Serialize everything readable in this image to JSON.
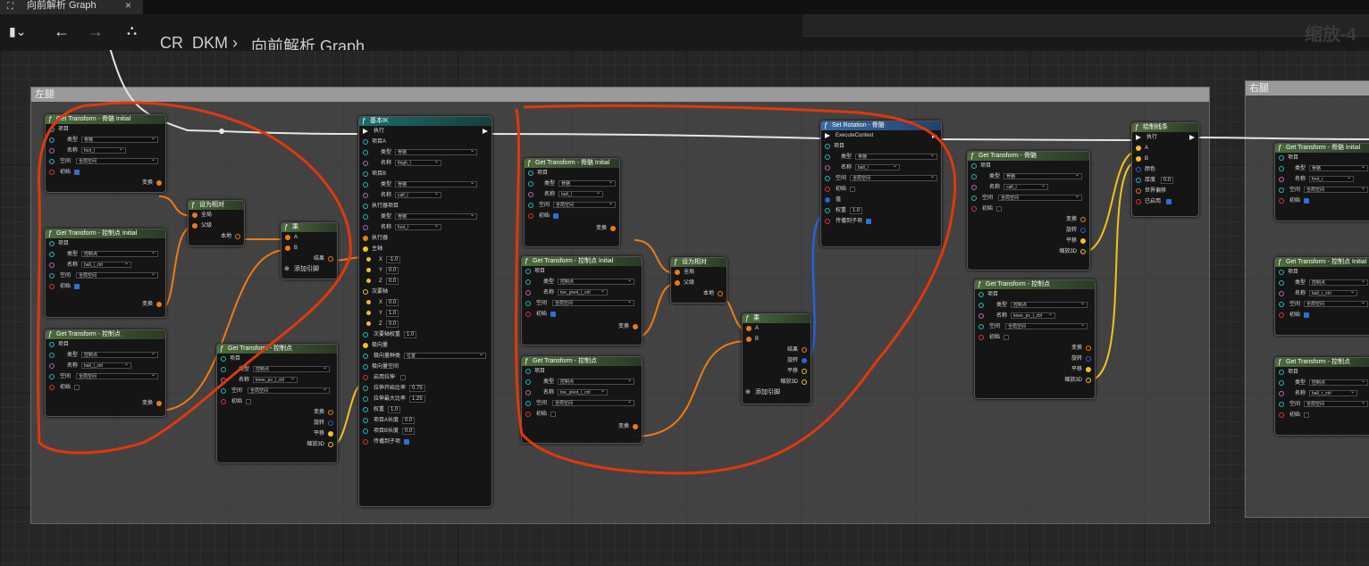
{
  "tab": {
    "title": "向前解析 Graph",
    "close": "×"
  },
  "toolbar": {
    "breadcrumb_root": "CR_DKM",
    "breadcrumb_sep": "›",
    "breadcrumb_graph": "向前解析 Graph",
    "zoom": "缩放-4"
  },
  "comments": {
    "left": "左腿",
    "right": "右腿"
  },
  "common": {
    "item": "项目",
    "type": "类型",
    "name": "名称",
    "space": "空间",
    "initial": "初始",
    "transform": "变换",
    "rotation": "旋转",
    "translation": "平移",
    "scale": "缩放3D",
    "bone": "骨骼",
    "control": "控制点",
    "global_space": "全局空间",
    "global": "全局",
    "parent": "父级",
    "local": "本地",
    "result": "结果",
    "add_pin": "添加引脚",
    "a": "A",
    "b": "B"
  },
  "nodes": {
    "gt_foot_l": {
      "title": "Get Transform - 骨骼 Initial",
      "name": "foot_l"
    },
    "gt_ballctrl_init": {
      "title": "Get Transform - 控制点 Initial",
      "name": "ball_l_ctrl"
    },
    "gt_ballctrl": {
      "title": "Get Transform - 控制点",
      "name": "ball_l_ctrl"
    },
    "make_rel_1": {
      "title": "设为相对"
    },
    "mul_1": {
      "title": "乘"
    },
    "gt_knee": {
      "title": "Get Transform - 控制点",
      "name": "knee_pv_l_ctrl"
    },
    "basic_ik": {
      "title": "基本IK",
      "exec": "执行",
      "item_a": "项目A",
      "type_val": "骨骼",
      "name_a": "thigh_l",
      "item_b": "项目B",
      "name_b": "calf_l",
      "effector": "执行器项目",
      "name_eff": "foot_l",
      "effector_pin": "执行器",
      "primary": "主轴",
      "x1": "-1.0",
      "y1": "0.0",
      "z1": "0.0",
      "secondary": "次要轴",
      "x2": "0.0",
      "y2": "1.0",
      "z2": "0.0",
      "sec_weight": "次要轴权重",
      "sec_weight_val": "1.0",
      "pole": "极向量",
      "pole_kind": "极向量种类",
      "pole_kind_val": "位置",
      "pole_space": "极向量空间",
      "stretch": "启用拉伸",
      "stretch_start": "拉伸开始比率",
      "stretch_start_val": "0.75",
      "stretch_max": "拉伸最大比率",
      "stretch_max_val": "1.25",
      "weight": "权重",
      "weight_val": "1.0",
      "len_a": "项目A长度",
      "len_a_val": "0.0",
      "len_b": "项目B长度",
      "len_b_val": "0.0",
      "propagate": "传播到子项"
    },
    "gt_ball_l": {
      "title": "Get Transform - 骨骼 Initial",
      "name": "ball_l"
    },
    "gt_toe_init": {
      "title": "Get Transform - 控制点 Initial",
      "name": "toe_pivot_l_ctrl"
    },
    "gt_toe": {
      "title": "Get Transform - 控制点",
      "name": "toe_pivot_l_ctrl"
    },
    "make_rel_2": {
      "title": "设为相对"
    },
    "mul_2": {
      "title": "乘"
    },
    "set_rot": {
      "title": "Set Rotation - 骨骼",
      "ctx": "ExecuteContext",
      "name": "ball_l",
      "value": "值",
      "weight": "权重",
      "weight_val": "1.0",
      "propagate": "传播到子项"
    },
    "gt_calf": {
      "title": "Get Transform - 骨骼",
      "name": "calf_l"
    },
    "gt_knee2": {
      "title": "Get Transform - 控制点",
      "name": "knee_pv_l_ctrl"
    },
    "draw_line": {
      "title": "绘制线条",
      "exec": "执行",
      "color": "颜色",
      "thickness": "厚度",
      "thickness_val": "0.0",
      "offset": "世界偏移",
      "enabled": "已启用"
    },
    "r_gt1": {
      "title": "Get Transform - 骨骼 Initial",
      "name": "foot_r"
    },
    "r_gt2": {
      "title": "Get Transform - 控制点 Initial",
      "name": "ball_r_ctrl"
    },
    "r_gt3": {
      "title": "Get Transform - 控制点",
      "name": "ball_r_ctrl"
    }
  },
  "colors": {
    "exec_wire": "#e6e6e6",
    "transform_wire": "#f07a12",
    "vector_wire": "#f2c21b",
    "quat_wire": "#2563d8",
    "annotation": "#e0380c"
  }
}
